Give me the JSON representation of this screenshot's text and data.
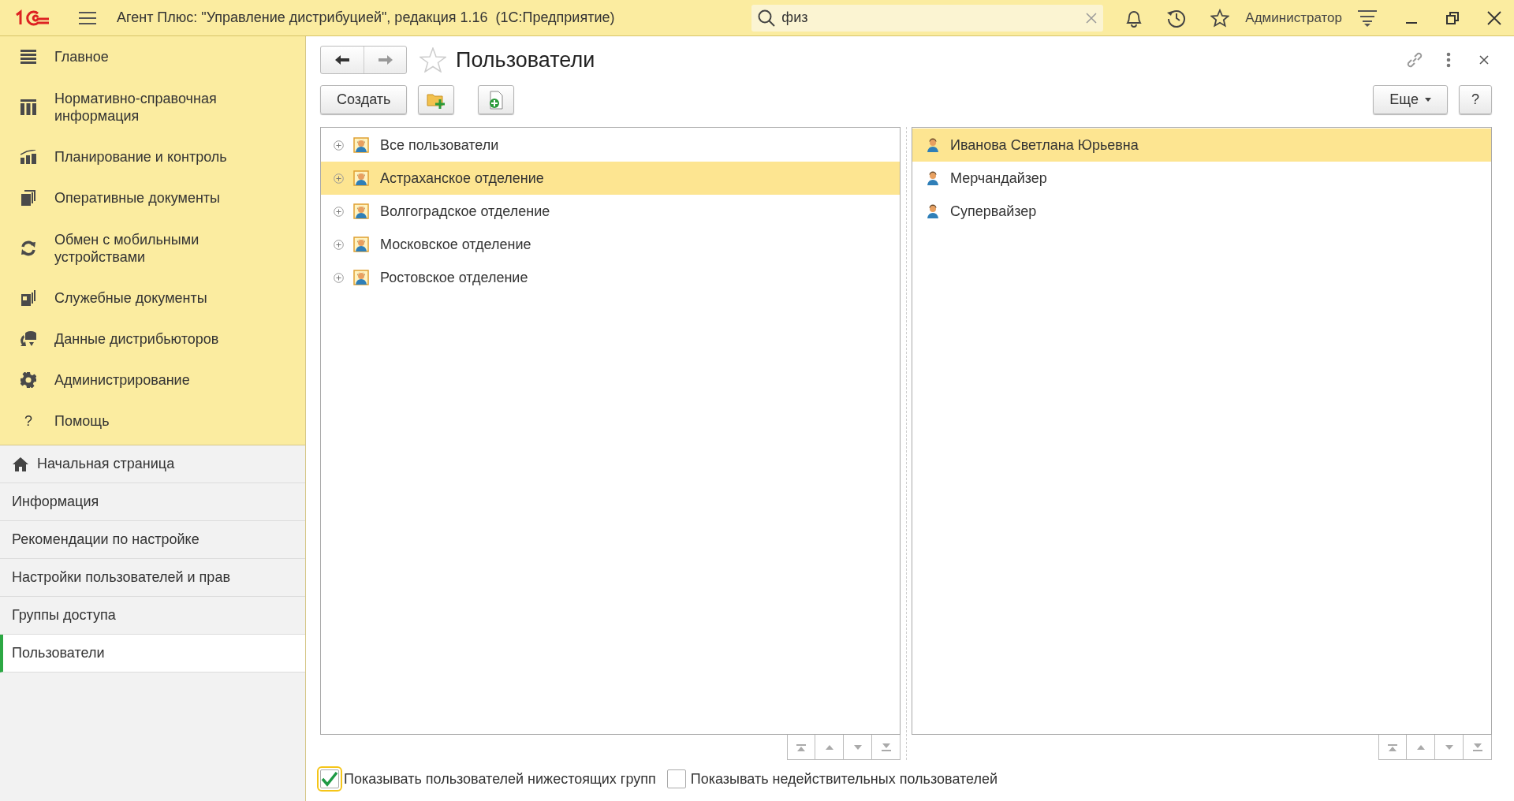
{
  "window": {
    "title": "Агент Плюс: \"Управление дистрибуцией\", редакция 1.16  (1С:Предприятие)"
  },
  "search": {
    "value": "физ"
  },
  "user": "Администратор",
  "sections": [
    {
      "label": "Главное"
    },
    {
      "label": "Нормативно-справочная информация"
    },
    {
      "label": "Планирование и контроль"
    },
    {
      "label": "Оперативные документы"
    },
    {
      "label": "Обмен с мобильными устройствами"
    },
    {
      "label": "Служебные документы"
    },
    {
      "label": "Данные дистрибьюторов"
    },
    {
      "label": "Администрирование"
    },
    {
      "label": "Помощь",
      "glyph": "?"
    }
  ],
  "nav": [
    {
      "label": "Начальная страница",
      "kind": "home",
      "selected": false
    },
    {
      "label": "Информация",
      "kind": "plain",
      "selected": false
    },
    {
      "label": "Рекомендации по настройке",
      "kind": "plain",
      "selected": false
    },
    {
      "label": "Настройки пользователей и прав",
      "kind": "plain",
      "selected": false
    },
    {
      "label": "Группы доступа",
      "kind": "plain",
      "selected": false
    },
    {
      "label": "Пользователи",
      "kind": "plain",
      "selected": true
    }
  ],
  "form": {
    "title": "Пользователи",
    "create": "Создать",
    "more": "Еще",
    "help": "?"
  },
  "groups": [
    {
      "label": "Все пользователи",
      "selected": false
    },
    {
      "label": "Астраханское отделение",
      "selected": true
    },
    {
      "label": "Волгоградское отделение",
      "selected": false
    },
    {
      "label": "Московское отделение",
      "selected": false
    },
    {
      "label": "Ростовское отделение",
      "selected": false
    }
  ],
  "users": [
    {
      "label": "Иванова Светлана Юрьевна",
      "selected": true
    },
    {
      "label": "Мерчандайзер",
      "selected": false
    },
    {
      "label": "Супервайзер",
      "selected": false
    }
  ],
  "options": [
    {
      "label": "Показывать пользователей нижестоящих групп",
      "checked": true
    },
    {
      "label": "Показывать недействительных пользователей",
      "checked": false
    }
  ]
}
